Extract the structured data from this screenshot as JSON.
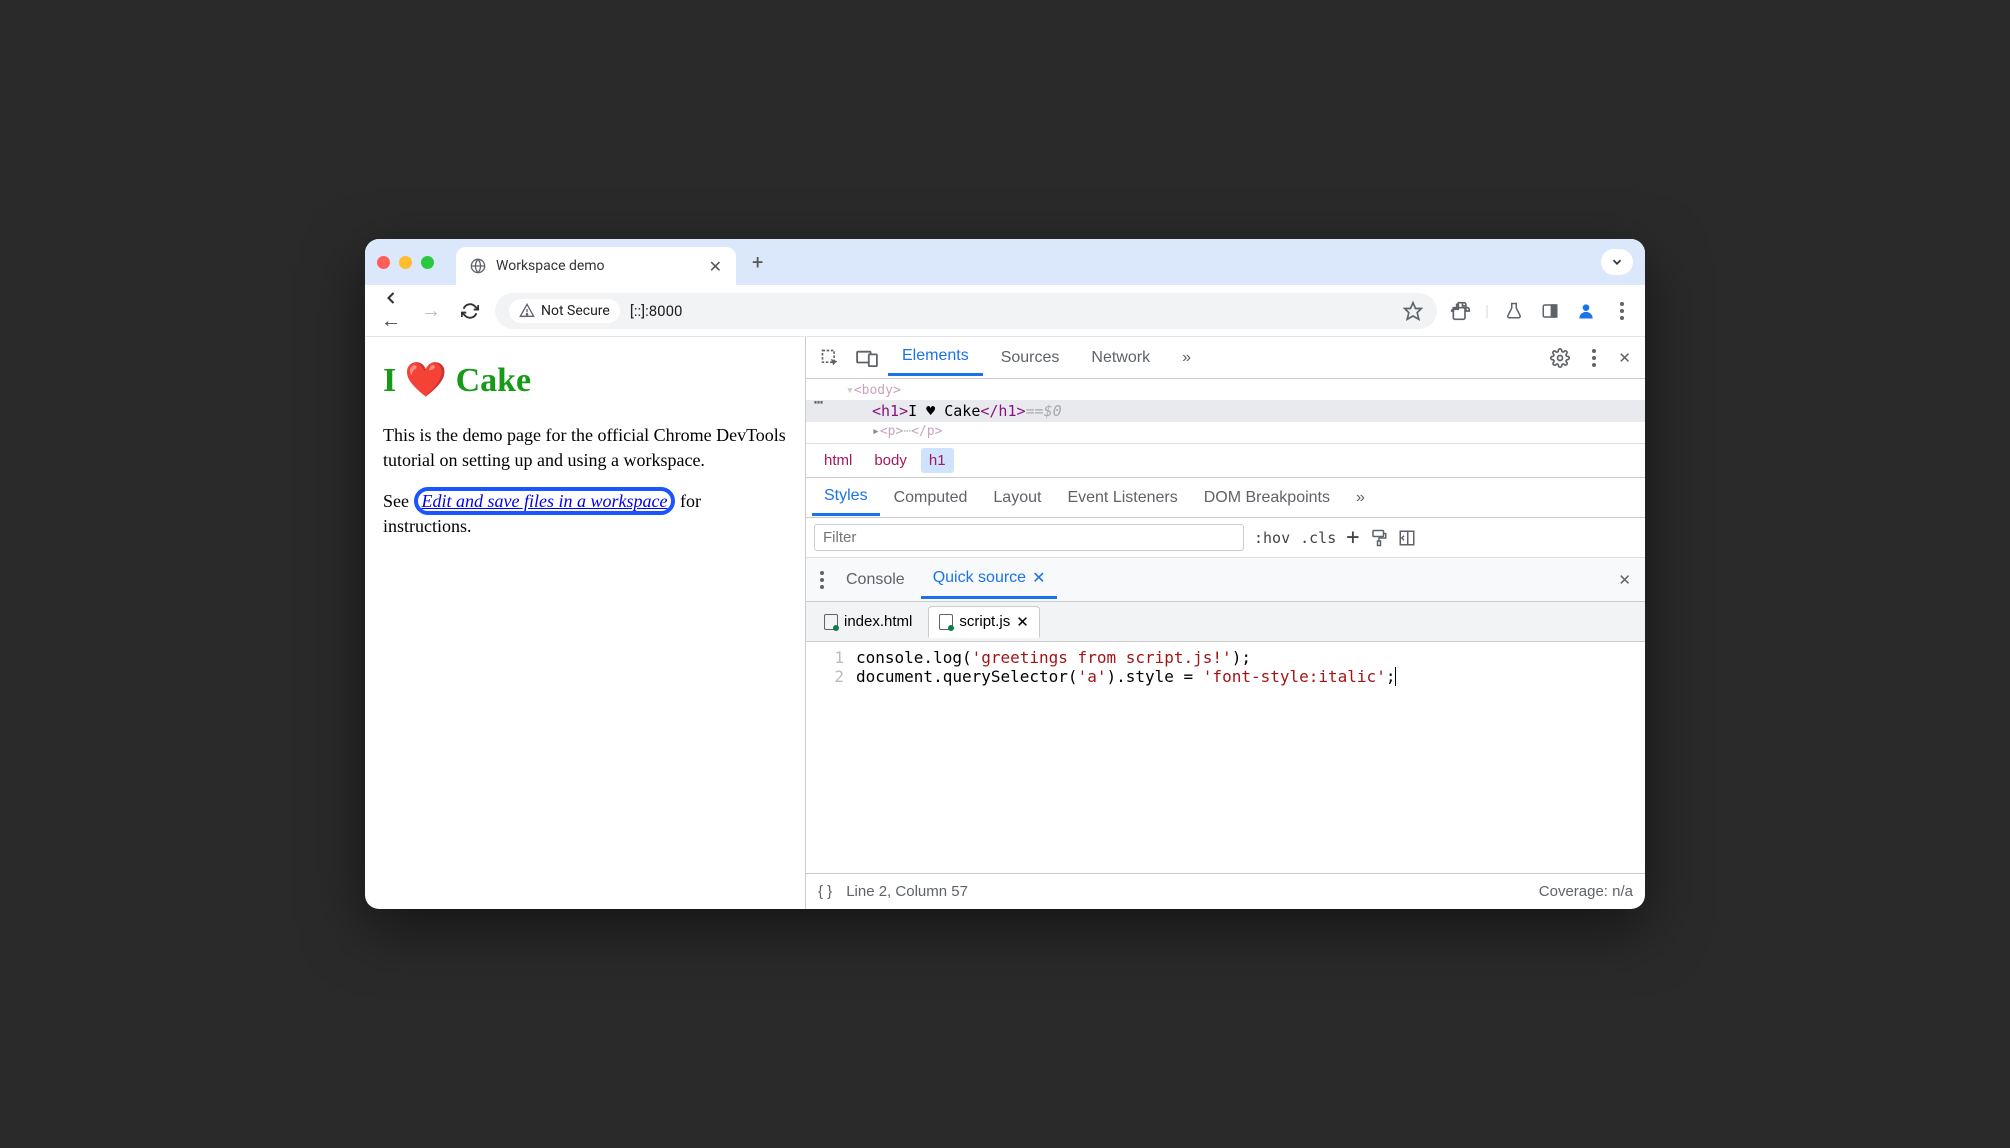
{
  "window": {
    "tab_title": "Workspace demo"
  },
  "addr": {
    "not_secure": "Not Secure",
    "url": "[::]:8000"
  },
  "page": {
    "heading": "I ❤️ Cake",
    "p1": "This is the demo page for the official Chrome DevTools tutorial on setting up and using a workspace.",
    "p2_pre": "See ",
    "p2_link": "Edit and save files in a workspace",
    "p2_post": " for instructions."
  },
  "devtools": {
    "tabs": {
      "elements": "Elements",
      "sources": "Sources",
      "network": "Network"
    },
    "dom": {
      "body_open": "<body>",
      "h1_open": "<h1>",
      "h1_text": "I ♥ Cake",
      "h1_close": "</h1>",
      "eq": " == ",
      "dollar": "$0",
      "p_open": "<p>",
      "p_close": "</p>"
    },
    "crumbs": {
      "html": "html",
      "body": "body",
      "h1": "h1"
    },
    "styles_tabs": {
      "styles": "Styles",
      "computed": "Computed",
      "layout": "Layout",
      "event": "Event Listeners",
      "dom_bp": "DOM Breakpoints"
    },
    "filter_placeholder": "Filter",
    "tools": {
      "hov": ":hov",
      "cls": ".cls"
    },
    "drawer": {
      "console": "Console",
      "quick": "Quick source"
    },
    "files": {
      "index": "index.html",
      "script": "script.js"
    },
    "code": {
      "l1_a": "console.log(",
      "l1_b": "'greetings from script.js!'",
      "l1_c": ");",
      "l2_a": "document.querySelector(",
      "l2_b": "'a'",
      "l2_c": ").style = ",
      "l2_d": "'font-style:italic'",
      "l2_e": ";"
    },
    "status": {
      "pos": "Line 2, Column 57",
      "cov": "Coverage: n/a"
    }
  }
}
